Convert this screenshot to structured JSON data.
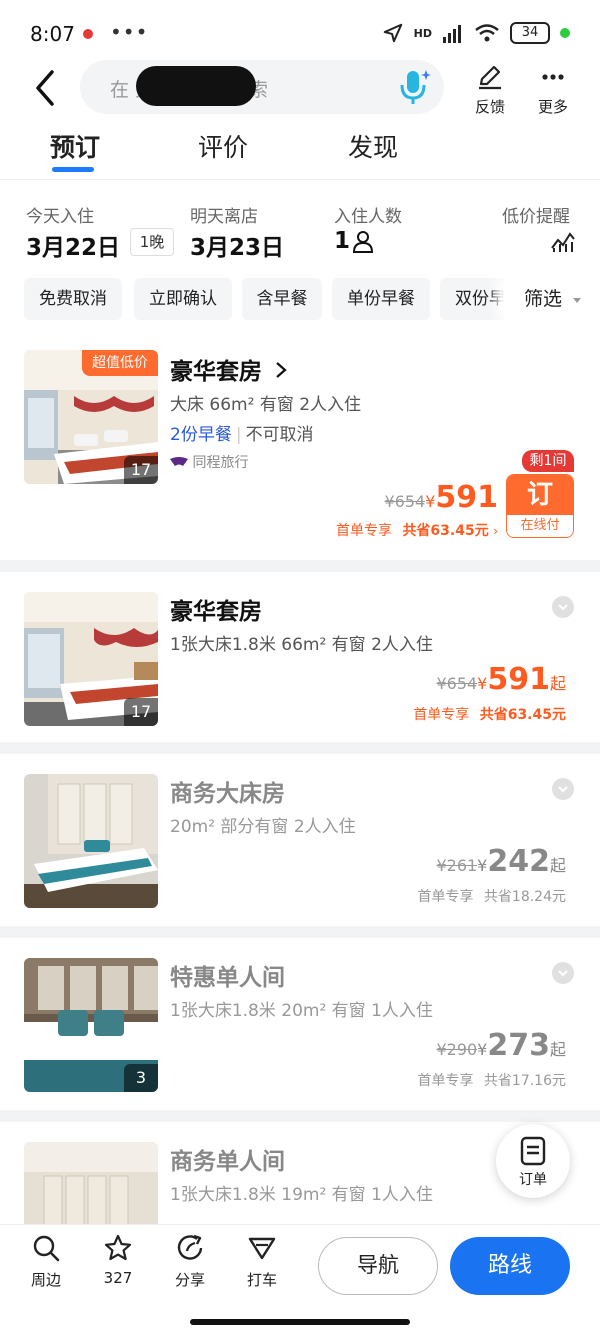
{
  "status_bar": {
    "time": "8:07",
    "more": "•••",
    "network": "HD",
    "battery": "34"
  },
  "header": {
    "search_placeholder": "在        大酒店附近搜索",
    "feedback_label": "反馈",
    "more_label": "更多"
  },
  "tabs": [
    {
      "label": "预订",
      "active": true
    },
    {
      "label": "评价",
      "active": false
    },
    {
      "label": "发现",
      "active": false
    }
  ],
  "dates": {
    "checkin_label": "今天入住",
    "checkin_date": "3月22日",
    "nights": "1晚",
    "checkout_label": "明天离店",
    "checkout_date": "3月23日",
    "guests_label": "入住人数",
    "guests_value": "1",
    "alert_label": "低价提醒"
  },
  "filters": {
    "chips": [
      "免费取消",
      "立即确认",
      "含早餐",
      "单份早餐",
      "双份早餐"
    ],
    "filter_label": "筛选"
  },
  "rooms": [
    {
      "tag": "超值低价",
      "name": "豪华套房",
      "spec": "大床  66m²  有窗  2人入住",
      "breakfast": "2份早餐",
      "cancel": "不可取消",
      "provider": "同程旅行",
      "photo_count": "17",
      "orig_price": "¥654",
      "yen": "¥",
      "price": "591",
      "promo_first": "首单专享",
      "promo_save": "共省63.45元",
      "remaining": "剩1间",
      "book_label": "订",
      "book_sub": "在线付"
    },
    {
      "name": "豪华套房",
      "spec": "1张大床1.8米  66m²  有窗  2人入住",
      "photo_count": "17",
      "orig_price": "¥654",
      "yen": "¥",
      "price": "591",
      "qi": "起",
      "promo_first": "首单专享",
      "promo_save": "共省63.45元"
    },
    {
      "name": "商务大床房",
      "spec": "20m²  部分有窗  2人入住",
      "orig_price": "¥261",
      "yen": "¥",
      "price": "242",
      "qi": "起",
      "promo_first": "首单专享",
      "promo_save": "共省18.24元"
    },
    {
      "name": "特惠单人间",
      "spec": "1张大床1.8米  20m²  有窗  1人入住",
      "photo_count": "3",
      "orig_price": "¥290",
      "yen": "¥",
      "price": "273",
      "qi": "起",
      "promo_first": "首单专享",
      "promo_save": "共省17.16元"
    },
    {
      "name": "商务单人间",
      "spec": "1张大床1.8米  19m²  有窗  1人入住"
    }
  ],
  "order_fab": {
    "label": "订单"
  },
  "bottom_bar": {
    "nearby": "周边",
    "favorites": "327",
    "share": "分享",
    "taxi": "打车",
    "navigate": "导航",
    "route": "路线"
  },
  "colors": {
    "accent_blue": "#1a73f0",
    "price_orange": "#ff5a1f",
    "tag_orange": "#ff6b2e"
  }
}
